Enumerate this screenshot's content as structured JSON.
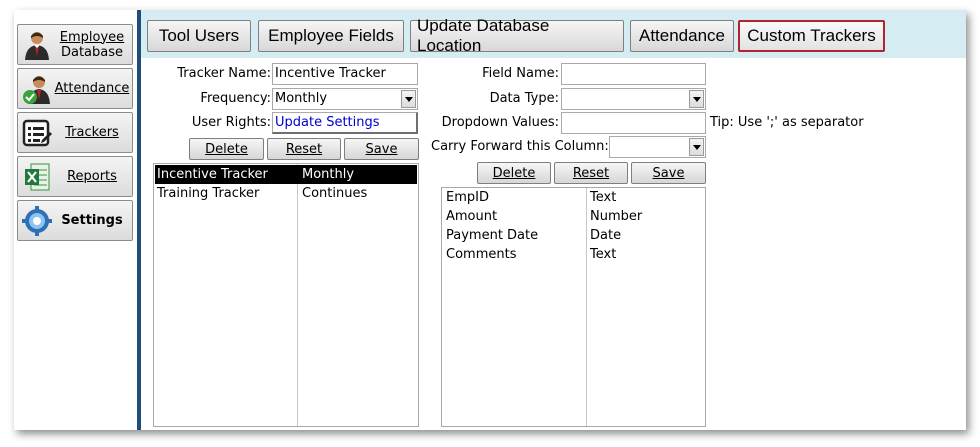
{
  "nav": {
    "items": [
      {
        "label_line1": "Employee",
        "label_line2": "Database",
        "icon": "employee-icon"
      },
      {
        "label": "Attendance",
        "icon": "attendance-icon"
      },
      {
        "label": "Trackers",
        "icon": "trackers-icon"
      },
      {
        "label": "Reports",
        "icon": "reports-icon"
      },
      {
        "label": "Settings",
        "icon": "settings-icon"
      }
    ]
  },
  "tabs": [
    {
      "label": "Tool Users"
    },
    {
      "label": "Employee Fields"
    },
    {
      "label": "Update Database Location"
    },
    {
      "label": "Attendance"
    },
    {
      "label": "Custom Trackers",
      "active": true
    }
  ],
  "tracker_form": {
    "name_label": "Tracker Name:",
    "name_value": "Incentive Tracker",
    "frequency_label": "Frequency:",
    "frequency_value": "Monthly",
    "rights_label": "User Rights:",
    "rights_value": "Update Settings",
    "delete_label": "Delete",
    "reset_label": "Reset",
    "save_label": "Save",
    "list": [
      {
        "name": "Incentive Tracker",
        "frequency": "Monthly",
        "selected": true
      },
      {
        "name": "Training Tracker",
        "frequency": "Continues",
        "selected": false
      }
    ]
  },
  "field_form": {
    "field_name_label": "Field Name:",
    "field_name_value": "",
    "data_type_label": "Data Type:",
    "data_type_value": "",
    "dropdown_label": "Dropdown Values:",
    "dropdown_value": "",
    "tip": "Tip: Use ';' as separator",
    "carry_label": "Carry Forward this Column:",
    "carry_value": "",
    "delete_label": "Delete",
    "reset_label": "Reset",
    "save_label": "Save",
    "list": [
      {
        "field": "EmpID",
        "type": "Text"
      },
      {
        "field": "Amount",
        "type": "Number"
      },
      {
        "field": "Payment Date",
        "type": "Date"
      },
      {
        "field": "Comments",
        "type": "Text"
      }
    ]
  },
  "colors": {
    "tabstrip_bg": "#d6ecf3",
    "active_tab_border": "#b2222f",
    "divider": "#1f4e79",
    "link": "#0000cc"
  }
}
